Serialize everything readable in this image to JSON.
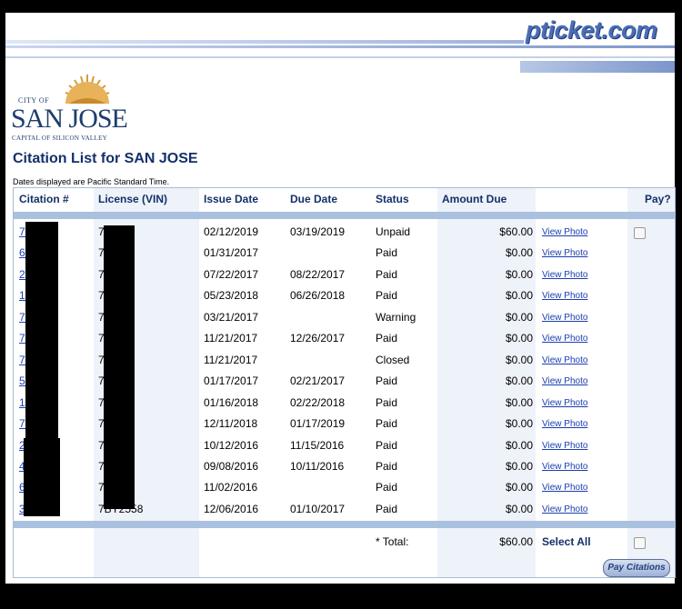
{
  "site_logo": "pticket.com",
  "city_logo": {
    "city_of": "CITY OF",
    "name": "SAN JOSE",
    "tagline": "CAPITAL OF SILICON VALLEY"
  },
  "page_title": "Citation List for SAN JOSE",
  "timezone_note": "Dates displayed are Pacific Standard Time.",
  "columns": {
    "citation": "Citation #",
    "license": "License (VIN)",
    "issue_date": "Issue Date",
    "due_date": "Due Date",
    "status": "Status",
    "amount_due": "Amount Due",
    "pay": "Pay?"
  },
  "rows": [
    {
      "citation": "76  93",
      "license": "7  8",
      "issue_date": "02/12/2019",
      "due_date": "03/19/2019",
      "status": "Unpaid",
      "amount": "$60.00",
      "photo": "View Photo"
    },
    {
      "citation": "66  01",
      "license": "7  8",
      "issue_date": "01/31/2017",
      "due_date": "",
      "status": "Paid",
      "amount": "$0.00",
      "photo": "View Photo"
    },
    {
      "citation": "27  64",
      "license": "7  8",
      "issue_date": "07/22/2017",
      "due_date": "08/22/2017",
      "status": "Paid",
      "amount": "$0.00",
      "photo": "View Photo"
    },
    {
      "citation": "15  44",
      "license": "7  8",
      "issue_date": "05/23/2018",
      "due_date": "06/26/2018",
      "status": "Paid",
      "amount": "$0.00",
      "photo": "View Photo"
    },
    {
      "citation": "73  78",
      "license": "7  8",
      "issue_date": "03/21/2017",
      "due_date": "",
      "status": "Warning",
      "amount": "$0.00",
      "photo": "View Photo"
    },
    {
      "citation": "73  80",
      "license": "7  8",
      "issue_date": "11/21/2017",
      "due_date": "12/26/2017",
      "status": "Paid",
      "amount": "$0.00",
      "photo": "View Photo"
    },
    {
      "citation": "73  29",
      "license": "7  8",
      "issue_date": "11/21/2017",
      "due_date": "",
      "status": "Closed",
      "amount": "$0.00",
      "photo": "View Photo"
    },
    {
      "citation": "50  21",
      "license": "7  8",
      "issue_date": "01/17/2017",
      "due_date": "02/21/2017",
      "status": "Paid",
      "amount": "$0.00",
      "photo": "View Photo"
    },
    {
      "citation": "17  68",
      "license": "7  8",
      "issue_date": "01/16/2018",
      "due_date": "02/22/2018",
      "status": "Paid",
      "amount": "$0.00",
      "photo": "View Photo"
    },
    {
      "citation": "76  88",
      "license": "7  8",
      "issue_date": "12/11/2018",
      "due_date": "01/17/2019",
      "status": "Paid",
      "amount": "$0.00",
      "photo": "View Photo"
    },
    {
      "citation": "2  1",
      "license": "7  58",
      "issue_date": "10/12/2016",
      "due_date": "11/15/2016",
      "status": "Paid",
      "amount": "$0.00",
      "photo": "View Photo"
    },
    {
      "citation": "4  9",
      "license": "7  58",
      "issue_date": "09/08/2016",
      "due_date": "10/11/2016",
      "status": "Paid",
      "amount": "$0.00",
      "photo": "View Photo"
    },
    {
      "citation": "6  9",
      "license": "7  58",
      "issue_date": "11/02/2016",
      "due_date": "",
      "status": "Paid",
      "amount": "$0.00",
      "photo": "View Photo"
    },
    {
      "citation": "3  6",
      "license": "7BY2558",
      "issue_date": "12/06/2016",
      "due_date": "01/10/2017",
      "status": "Paid",
      "amount": "$0.00",
      "photo": "View Photo"
    }
  ],
  "footer": {
    "total_label": "* Total:",
    "total_amount": "$60.00",
    "select_all": "Select All",
    "pay_button": "Pay Citations"
  },
  "colors": {
    "link": "#1a3fb0",
    "header_text": "#13306a",
    "band": "#a9c0df"
  }
}
